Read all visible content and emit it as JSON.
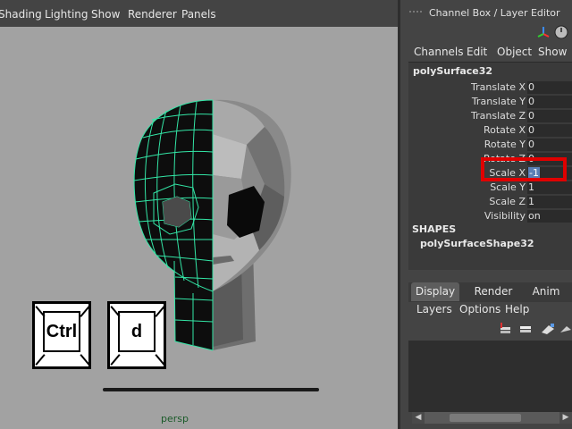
{
  "viewport_menu": [
    "Shading",
    "Lighting",
    "Show",
    "Renderer",
    "Panels"
  ],
  "camera_label": "persp",
  "keys": {
    "ctrl": "Ctrl",
    "d": "d"
  },
  "channel_box": {
    "title": "Channel Box / Layer Editor",
    "menu": [
      "Channels",
      "Edit",
      "Object",
      "Show"
    ],
    "object_name": "polySurface32",
    "attributes": [
      {
        "label": "Translate X",
        "value": "0"
      },
      {
        "label": "Translate Y",
        "value": "0"
      },
      {
        "label": "Translate Z",
        "value": "0"
      },
      {
        "label": "Rotate X",
        "value": "0"
      },
      {
        "label": "Rotate Y",
        "value": "0"
      },
      {
        "label": "Rotate Z",
        "value": "0"
      },
      {
        "label": "Scale X",
        "value": "-1"
      },
      {
        "label": "Scale Y",
        "value": "1"
      },
      {
        "label": "Scale Z",
        "value": "1"
      },
      {
        "label": "Visibility",
        "value": "on"
      }
    ],
    "shapes_header": "SHAPES",
    "shape_name": "polySurfaceShape32"
  },
  "layer_editor": {
    "tabs": [
      "Display",
      "Render",
      "Anim"
    ],
    "active_tab": "Display",
    "menu": [
      "Layers",
      "Options",
      "Help"
    ]
  },
  "colors": {
    "wireframe": "#33e6a6",
    "highlight": "#e00000",
    "viewport_bg": "#a2a2a2"
  }
}
